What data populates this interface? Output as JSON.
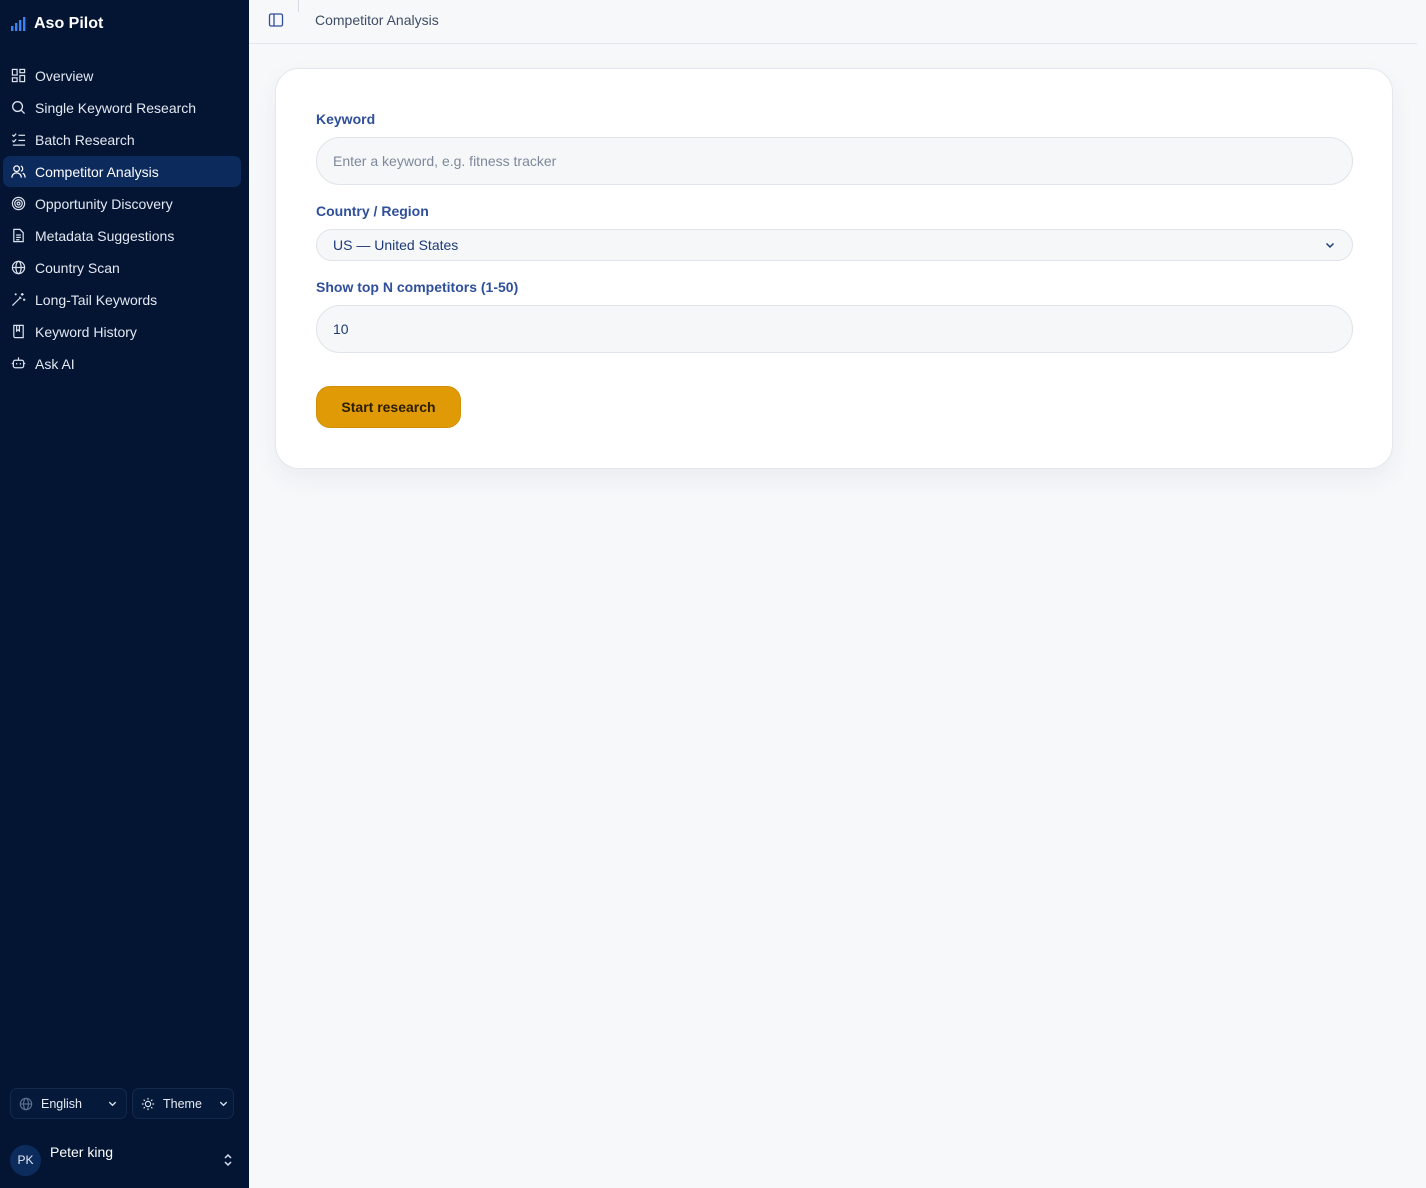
{
  "app": {
    "name": "Aso Pilot"
  },
  "sidebar": {
    "items": [
      {
        "label": "Overview",
        "icon": "dashboard-icon",
        "active": false
      },
      {
        "label": "Single Keyword Research",
        "icon": "search-icon",
        "active": false
      },
      {
        "label": "Batch Research",
        "icon": "list-checks-icon",
        "active": false
      },
      {
        "label": "Competitor Analysis",
        "icon": "users-icon",
        "active": true
      },
      {
        "label": "Opportunity Discovery",
        "icon": "target-icon",
        "active": false
      },
      {
        "label": "Metadata Suggestions",
        "icon": "document-icon",
        "active": false
      },
      {
        "label": "Country Scan",
        "icon": "globe-icon",
        "active": false
      },
      {
        "label": "Long-Tail Keywords",
        "icon": "magic-wand-icon",
        "active": false
      },
      {
        "label": "Keyword History",
        "icon": "book-icon",
        "active": false
      },
      {
        "label": "Ask AI",
        "icon": "bot-icon",
        "active": false
      }
    ],
    "language": "English",
    "theme": "Theme",
    "user": {
      "initials": "PK",
      "name": "Peter king"
    }
  },
  "header": {
    "breadcrumb": "Competitor Analysis"
  },
  "form": {
    "keyword_label": "Keyword",
    "keyword_placeholder": "Enter a keyword, e.g. fitness tracker",
    "keyword_value": "",
    "country_label": "Country / Region",
    "country_value": "US — United States",
    "topn_label": "Show top N competitors (1-50)",
    "topn_value": "10",
    "submit_label": "Start research"
  },
  "colors": {
    "sidebar_bg": "#041533",
    "active_item_bg": "#0c2a5c",
    "accent_button": "#e09a06",
    "label_blue": "#2f4f9a"
  }
}
